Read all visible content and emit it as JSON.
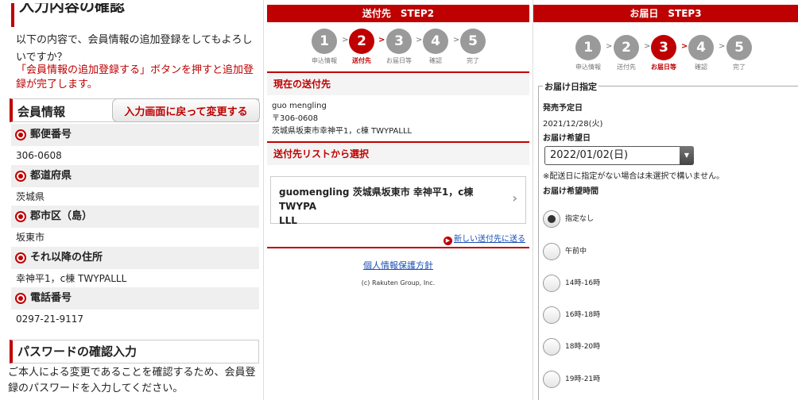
{
  "panel1": {
    "title": "入力内容の確認",
    "intro": "以下の内容で、会員情報の追加登録をしてもよろしいですか？",
    "note": "「会員情報の追加登録する」ボタンを押すと追加登録が完了します。",
    "section_title": "会員情報",
    "back_button": "入力画面に戻って変更する",
    "fields": [
      {
        "label": "郵便番号",
        "value": "306-0608"
      },
      {
        "label": "都道府県",
        "value": "茨城県"
      },
      {
        "label": "郡市区（島）",
        "value": "坂東市"
      },
      {
        "label": "それ以降の住所",
        "value": "幸神平1，c棟 TWYPALLL"
      },
      {
        "label": "電話番号",
        "value": "0297-21-9117"
      }
    ],
    "password_title": "パスワードの確認入力",
    "password_text": "ご本人による変更であることを確認するため、会員登録のパスワードを入力してください。"
  },
  "panel2": {
    "header": "送付先　STEP2",
    "steps": [
      {
        "num": "1",
        "label": "申込情報"
      },
      {
        "num": "2",
        "label": "送付先"
      },
      {
        "num": "3",
        "label": "お届日等"
      },
      {
        "num": "4",
        "label": "確認"
      },
      {
        "num": "5",
        "label": "完了"
      }
    ],
    "current_title": "現在の送付先",
    "name": "guo mengling",
    "postal": "〒306-0608",
    "address": "茨城県坂東市幸神平1，c棟 TWYPALLL",
    "list_title": "送付先リストから選択",
    "card_line1": "guomengling 茨城県坂東市 幸神平1，c棟 TWYPA",
    "card_line2": "LLL",
    "new_link": "新しい送付先に送る",
    "privacy": "個人情報保護方針",
    "copyright": "(c) Rakuten Group, Inc."
  },
  "panel3": {
    "header": "お届日　STEP3",
    "steps": [
      {
        "num": "1",
        "label": "申込情報"
      },
      {
        "num": "2",
        "label": "送付先"
      },
      {
        "num": "3",
        "label": "お届日等"
      },
      {
        "num": "4",
        "label": "確認"
      },
      {
        "num": "5",
        "label": "完了"
      }
    ],
    "legend": "お届け日指定",
    "release_label": "発売予定日",
    "release_value": "2021/12/28(火)",
    "date_label": "お届け希望日",
    "date_value": "2022/01/02(日)",
    "date_note": "※配送日に指定がない場合は未選択で構いません。",
    "time_label": "お届け希望時間",
    "time_options": [
      "指定なし",
      "午前中",
      "14時-16時",
      "16時-18時",
      "18時-20時",
      "19時-21時"
    ],
    "time_selected": "指定なし"
  },
  "colors": {
    "accent": "#bf0000",
    "link": "#1a4fb5",
    "inactive_step": "#9a9a9a"
  }
}
